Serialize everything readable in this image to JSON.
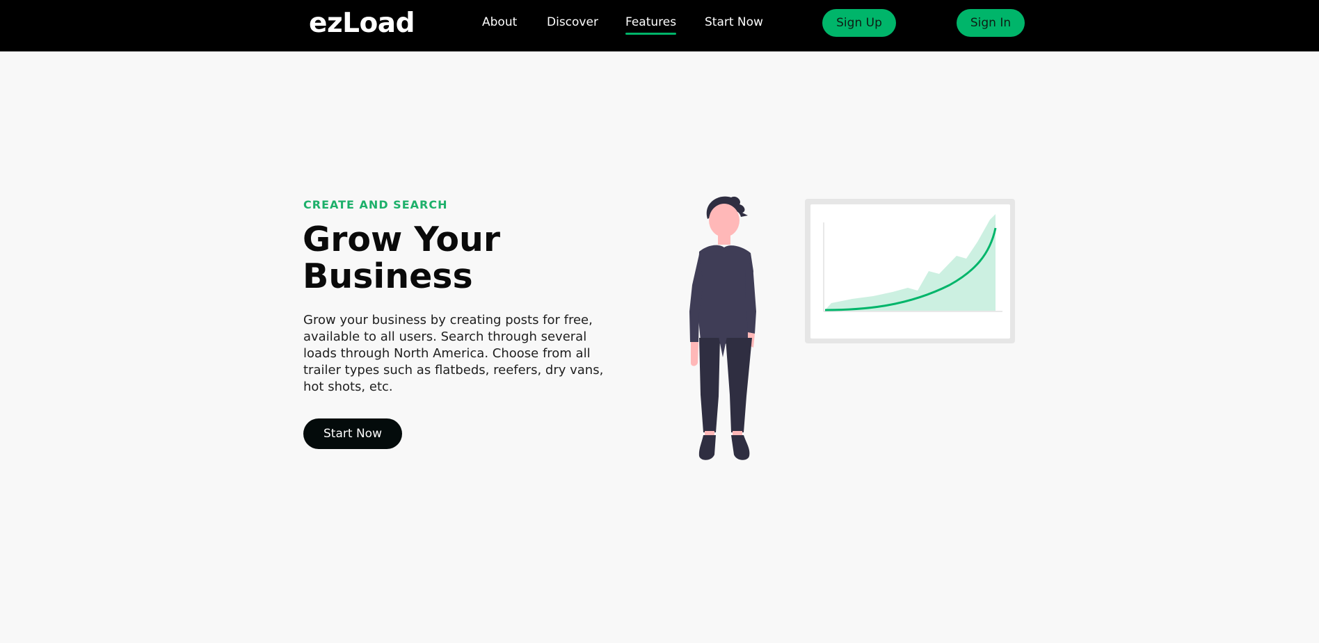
{
  "header": {
    "logo": "ezLoad",
    "nav": [
      {
        "label": "About"
      },
      {
        "label": "Discover"
      },
      {
        "label": "Features",
        "active": true
      },
      {
        "label": "Start Now"
      }
    ],
    "sign_up_label": "Sign Up",
    "sign_in_label": "Sign In"
  },
  "hero": {
    "eyebrow": "CREATE AND SEARCH",
    "headline_line1": "Grow Your",
    "headline_line2": "Business",
    "description": "Grow your business by creating posts for free, available to all users. Search through several loads through North America. Choose from all trailer types such as flatbeds, reefers, dry vans, hot shots, etc.",
    "cta_label": "Start Now"
  },
  "colors": {
    "accent": "#00b56a",
    "nav_bg": "#000000",
    "page_bg": "#f8f8f8",
    "dark_button": "#040b0b"
  }
}
